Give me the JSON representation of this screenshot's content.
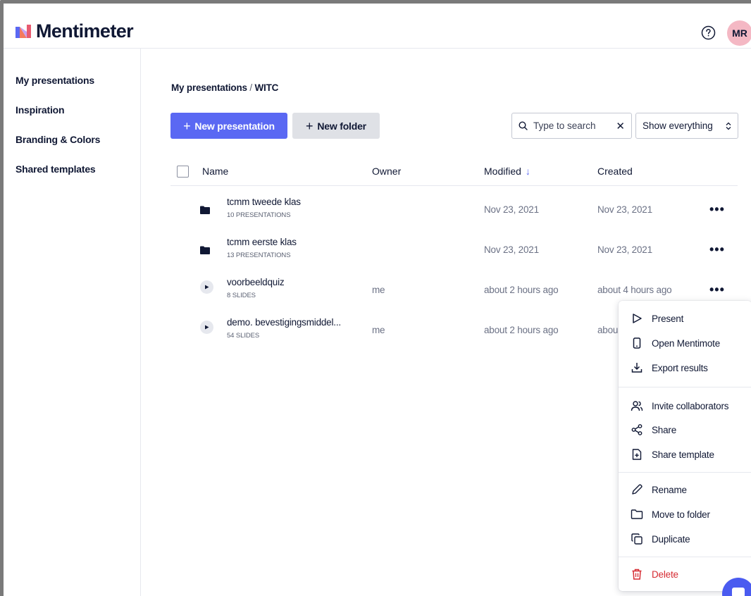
{
  "app": {
    "logo_text": "Mentimeter",
    "avatar_initials": "MR",
    "accent_color": "#5a68f3",
    "danger_color": "#d62c33"
  },
  "sidebar": {
    "items": [
      {
        "label": "My presentations"
      },
      {
        "label": "Inspiration"
      },
      {
        "label": "Branding & Colors"
      },
      {
        "label": "Shared templates"
      }
    ]
  },
  "breadcrumb": {
    "parent": "My presentations",
    "separator": "/",
    "current": "WITC"
  },
  "toolbar": {
    "new_presentation_label": "New presentation",
    "new_folder_label": "New folder",
    "search_placeholder": "Type to search",
    "filter_value": "Show everything"
  },
  "table": {
    "headers": {
      "name": "Name",
      "owner": "Owner",
      "modified": "Modified",
      "created": "Created"
    },
    "sort_column": "Modified",
    "rows": [
      {
        "type": "folder",
        "title": "tcmm tweede klas",
        "subtitle": "10 PRESENTATIONS",
        "owner": "",
        "modified": "Nov 23, 2021",
        "created": "Nov 23, 2021"
      },
      {
        "type": "folder",
        "title": "tcmm eerste klas",
        "subtitle": "13 PRESENTATIONS",
        "owner": "",
        "modified": "Nov 23, 2021",
        "created": "Nov 23, 2021"
      },
      {
        "type": "presentation",
        "title": "voorbeeldquiz",
        "subtitle": "8 SLIDES",
        "owner": "me",
        "modified": "about 2 hours ago",
        "created": "about 4 hours ago"
      },
      {
        "type": "presentation",
        "title": "demo. bevestigingsmiddel...",
        "subtitle": "54 SLIDES",
        "owner": "me",
        "modified": "about 2 hours ago",
        "created": "abou"
      }
    ]
  },
  "context_menu": {
    "items": [
      {
        "label": "Present",
        "icon": "play-outline-icon"
      },
      {
        "label": "Open Mentimote",
        "icon": "phone-icon"
      },
      {
        "label": "Export results",
        "icon": "download-icon"
      },
      {
        "label": "Invite collaborators",
        "icon": "users-icon"
      },
      {
        "label": "Share",
        "icon": "share-icon"
      },
      {
        "label": "Share template",
        "icon": "file-plus-icon"
      },
      {
        "label": "Rename",
        "icon": "pencil-icon"
      },
      {
        "label": "Move to folder",
        "icon": "folder-outline-icon"
      },
      {
        "label": "Duplicate",
        "icon": "copy-icon"
      },
      {
        "label": "Delete",
        "icon": "trash-icon"
      }
    ]
  }
}
